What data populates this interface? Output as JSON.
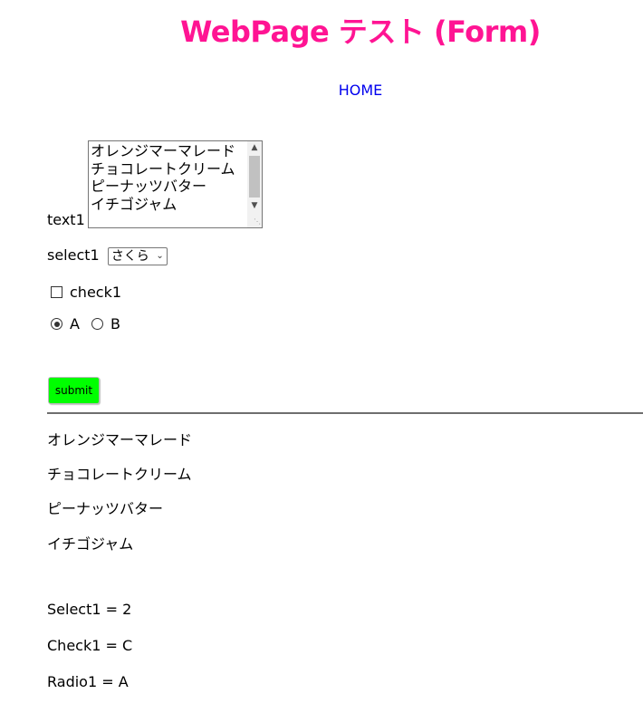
{
  "header": {
    "title": "WebPage テスト (Form)",
    "title_color": "#ff1493",
    "home_link": "HOME",
    "link_color": "#0000ee"
  },
  "form": {
    "text1": {
      "label": "text1",
      "lines": [
        "オレンジマーマレード",
        "チョコレートクリーム",
        "ピーナッツバター",
        "イチゴジャム"
      ]
    },
    "select1": {
      "label": "select1",
      "selected": "さくら"
    },
    "check1": {
      "label": "check1",
      "checked": false
    },
    "radio": {
      "options": [
        {
          "label": "A",
          "checked": true
        },
        {
          "label": "B",
          "checked": false
        }
      ]
    },
    "submit": {
      "label": "submit",
      "color": "#00ff00"
    }
  },
  "results": {
    "lines": [
      "オレンジマーマレード",
      "チョコレートクリーム",
      "ピーナッツバター",
      "イチゴジャム"
    ],
    "select1": "Select1 = 2",
    "check1": "Check1 = C",
    "radio1": "Radio1 = A"
  },
  "icons": {
    "scroll_up": "chevron-up-icon",
    "scroll_down": "chevron-down-icon",
    "select_arrow": "chevron-down-icon",
    "resize": "resize-grip-icon"
  }
}
